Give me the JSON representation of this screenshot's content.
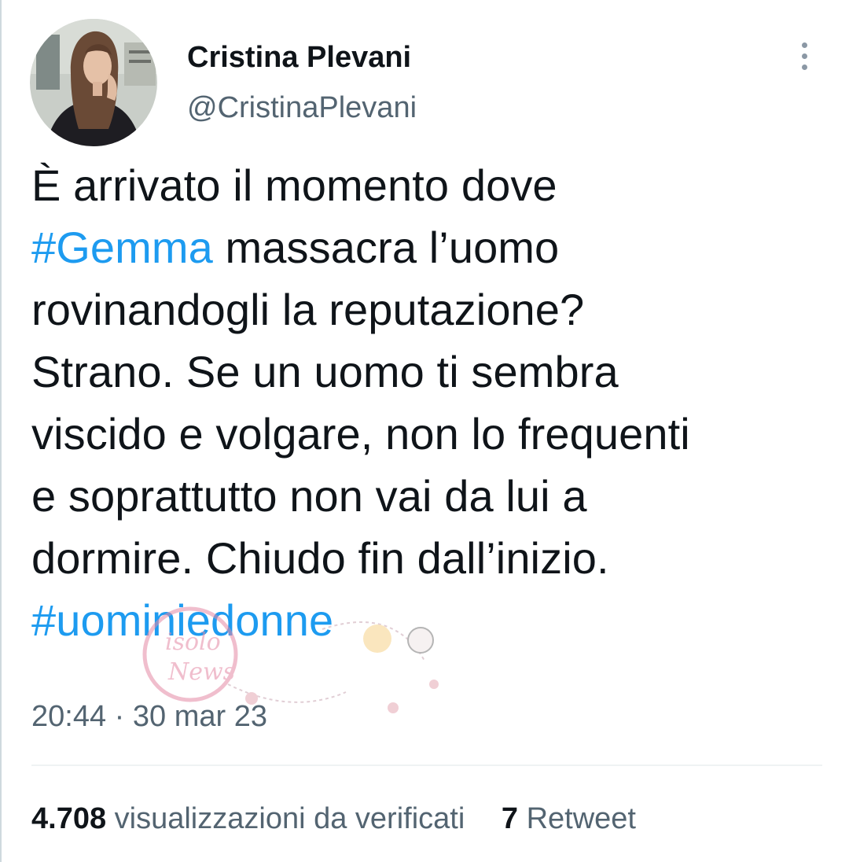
{
  "author": {
    "display_name": "Cristina Plevani",
    "handle": "@CristinaPlevani",
    "avatar_icon": "profile-photo"
  },
  "more_icon": "vertical-ellipsis-icon",
  "tweet": {
    "lines": [
      [
        {
          "text": "È arrivato il momento dove",
          "type": "text"
        }
      ],
      [
        {
          "text": "#Gemma",
          "type": "hashtag"
        },
        {
          "text": " massacra l’uomo",
          "type": "text"
        }
      ],
      [
        {
          "text": "rovinandogli la reputazione?",
          "type": "text"
        }
      ],
      [
        {
          "text": "Strano. Se un uomo ti sembra",
          "type": "text"
        }
      ],
      [
        {
          "text": "viscido e volgare, non lo frequenti",
          "type": "text"
        }
      ],
      [
        {
          "text": "e soprattutto non vai da lui a",
          "type": "text"
        }
      ],
      [
        {
          "text": "dormire. Chiudo fin dall’inizio.",
          "type": "text"
        }
      ],
      [
        {
          "text": "#uominiedonne",
          "type": "hashtag"
        }
      ]
    ],
    "time": "20:44",
    "separator": "·",
    "date": "30 mar 23"
  },
  "stats": {
    "views_value": "4.708",
    "views_label": "visualizzazioni da verificati",
    "retweets_value": "7",
    "retweets_label": "Retweet"
  },
  "colors": {
    "hashtag": "#1d9bf0",
    "secondary_text": "#536471",
    "primary_text": "#0f1419",
    "divider": "#eff3f4"
  },
  "watermark": {
    "text_1": "isolo",
    "text_2": "News"
  }
}
